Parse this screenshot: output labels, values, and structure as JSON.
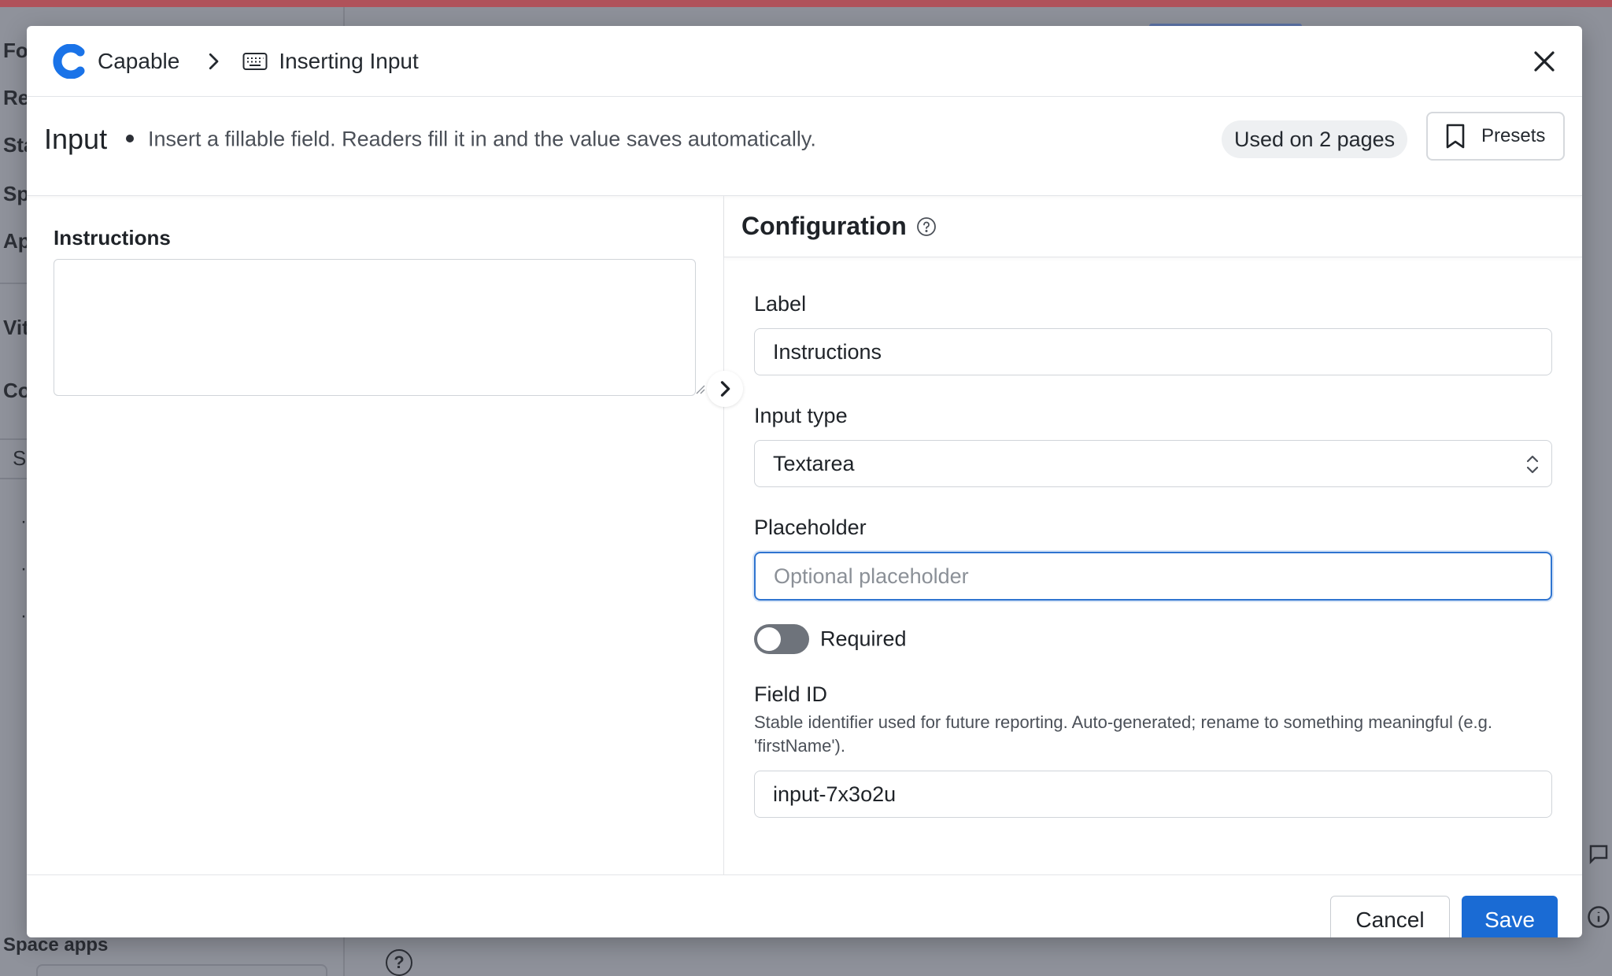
{
  "background": {
    "sidebar_items": [
      "Fo",
      "Re",
      "Sta",
      "Sp",
      "Ap",
      "Vit",
      "Co"
    ],
    "search_hint": "S",
    "bottom_label": "Space apps",
    "bottom_more": "..."
  },
  "header": {
    "app_name": "Capable",
    "breadcrumb_page": "Inserting Input"
  },
  "subheader": {
    "title": "Input",
    "description": "Insert a fillable field. Readers fill it in and the value saves automatically.",
    "usage_badge": "Used on 2 pages",
    "presets_label": "Presets"
  },
  "preview": {
    "field_label": "Instructions",
    "textarea_value": ""
  },
  "config": {
    "title": "Configuration",
    "label_field": {
      "label": "Label",
      "value": "Instructions"
    },
    "input_type": {
      "label": "Input type",
      "selected": "Textarea"
    },
    "placeholder_field": {
      "label": "Placeholder",
      "value": "",
      "placeholder": "Optional placeholder"
    },
    "required": {
      "label": "Required",
      "enabled": false
    },
    "field_id": {
      "label": "Field ID",
      "help": "Stable identifier used for future reporting. Auto-generated; rename to something meaningful (e.g. 'firstName').",
      "value": "input-7x3o2u"
    }
  },
  "footer": {
    "cancel_label": "Cancel",
    "save_label": "Save"
  },
  "colors": {
    "primary": "#1a6bd4",
    "focus_ring": "#2f74d0",
    "logo": "#1a73e8",
    "toggle_off": "#6e737b",
    "overlay_header": "#b0525a"
  }
}
